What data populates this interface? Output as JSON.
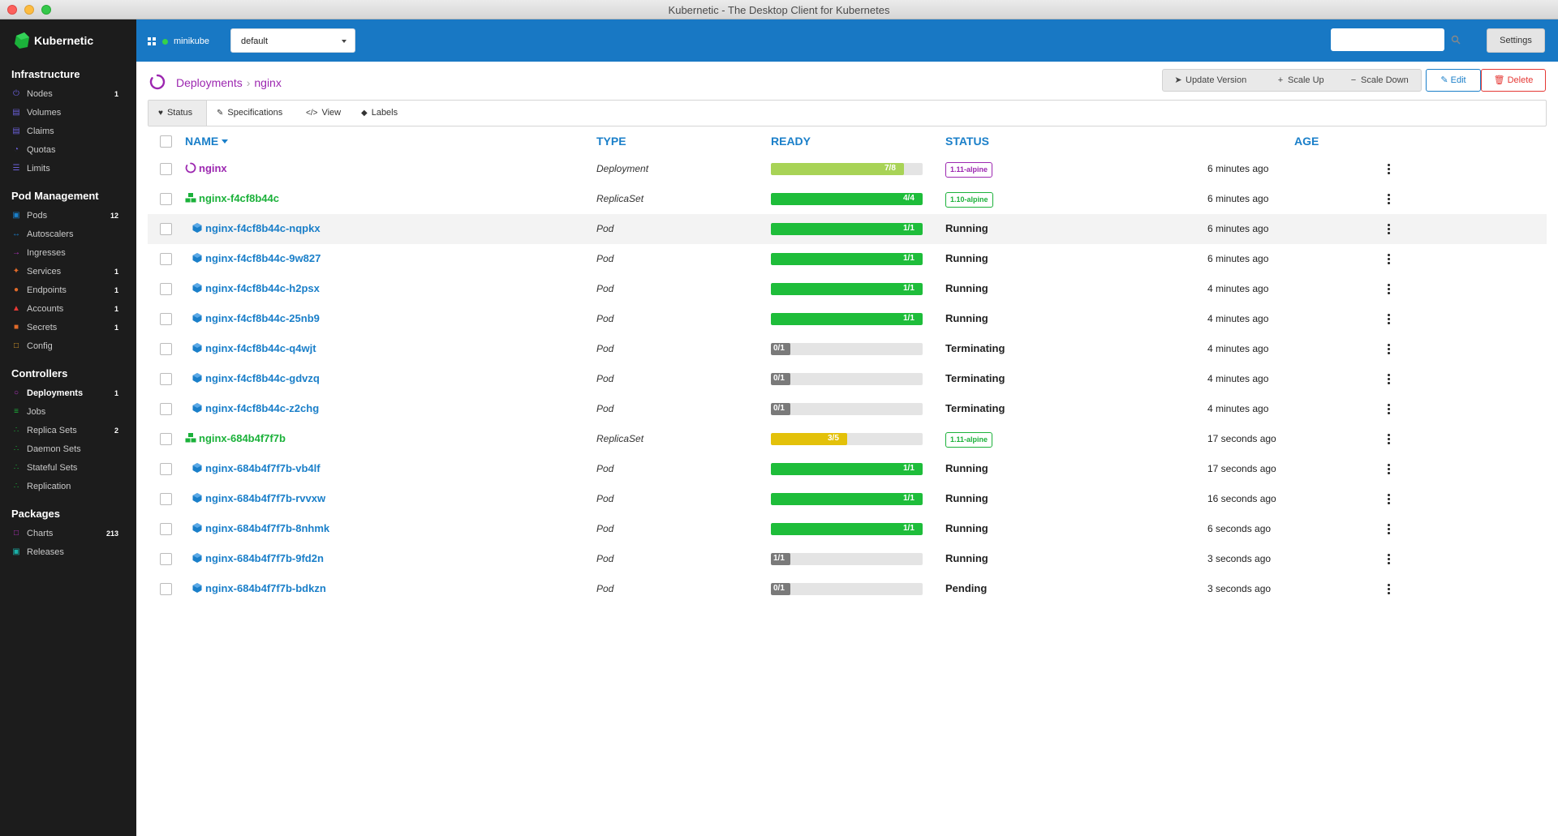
{
  "window": {
    "title": "Kubernetic - The Desktop Client for Kubernetes"
  },
  "brand": {
    "name": "Kubernetic"
  },
  "colors": {
    "sidebar": "#1c1c1c",
    "topbar": "#1878c4",
    "link": "#1a7fc9",
    "deployment": "#9c27b0",
    "replicaset": "#1bb13a",
    "ready_full": "#1ebd3a",
    "ready_partial_deploy": "#a8d356",
    "ready_partial_rs": "#e3c10a",
    "ready_zero": "#7a7a7a"
  },
  "sidebar": {
    "sections": [
      {
        "heading": "Infrastructure",
        "items": [
          {
            "label": "Nodes",
            "count": "1",
            "icon": "power-icon",
            "color": "#6a5fd6"
          },
          {
            "label": "Volumes",
            "count": "",
            "icon": "database-icon",
            "color": "#6a5fd6"
          },
          {
            "label": "Claims",
            "count": "",
            "icon": "database-icon",
            "color": "#6a5fd6"
          },
          {
            "label": "Quotas",
            "count": "",
            "icon": "gauge-icon",
            "color": "#6a5fd6"
          },
          {
            "label": "Limits",
            "count": "",
            "icon": "sliders-icon",
            "color": "#6a5fd6"
          }
        ]
      },
      {
        "heading": "Pod Management",
        "items": [
          {
            "label": "Pods",
            "count": "12",
            "icon": "cube-icon",
            "color": "#1a7fc9"
          },
          {
            "label": "Autoscalers",
            "count": "",
            "icon": "arrows-horizontal-icon",
            "color": "#1a7fc9"
          },
          {
            "label": "Ingresses",
            "count": "",
            "icon": "sign-in-icon",
            "color": "#b833c4"
          },
          {
            "label": "Services",
            "count": "1",
            "icon": "plug-icon",
            "color": "#e06a2a"
          },
          {
            "label": "Endpoints",
            "count": "1",
            "icon": "pin-icon",
            "color": "#e06a2a"
          },
          {
            "label": "Accounts",
            "count": "1",
            "icon": "user-icon",
            "color": "#e53935"
          },
          {
            "label": "Secrets",
            "count": "1",
            "icon": "lock-icon",
            "color": "#e06a2a"
          },
          {
            "label": "Config",
            "count": "",
            "icon": "map-icon",
            "color": "#e0a02a"
          }
        ]
      },
      {
        "heading": "Controllers",
        "items": [
          {
            "label": "Deployments",
            "count": "1",
            "icon": "circle-notch-icon",
            "color": "#b833c4",
            "active": true
          },
          {
            "label": "Jobs",
            "count": "",
            "icon": "tasks-icon",
            "color": "#1bb13a"
          },
          {
            "label": "Replica Sets",
            "count": "2",
            "icon": "cubes-icon",
            "color": "#1bb13a"
          },
          {
            "label": "Daemon Sets",
            "count": "",
            "icon": "cubes-icon",
            "color": "#1bb13a"
          },
          {
            "label": "Stateful Sets",
            "count": "",
            "icon": "cubes-icon",
            "color": "#1bb13a"
          },
          {
            "label": "Replication",
            "count": "",
            "icon": "cubes-icon",
            "color": "#1bb13a"
          }
        ]
      },
      {
        "heading": "Packages",
        "items": [
          {
            "label": "Charts",
            "count": "213",
            "icon": "map-icon",
            "color": "#b833c4"
          },
          {
            "label": "Releases",
            "count": "",
            "icon": "box-icon",
            "color": "#1ab0a8"
          }
        ]
      }
    ]
  },
  "topbar": {
    "cluster": "minikube",
    "namespace": "default",
    "search_placeholder": "",
    "settings_label": "Settings"
  },
  "breadcrumb": {
    "parent": "Deployments",
    "current": "nginx"
  },
  "actions": {
    "update_version": "Update Version",
    "scale_up": "Scale Up",
    "scale_down": "Scale Down",
    "edit": "Edit",
    "delete": "Delete"
  },
  "tabs": [
    {
      "label": "Status",
      "icon": "heartbeat-icon",
      "active": true
    },
    {
      "label": "Specifications",
      "icon": "pencil-icon"
    },
    {
      "label": "View",
      "icon": "code-icon"
    },
    {
      "label": "Labels",
      "icon": "tags-icon"
    }
  ],
  "table": {
    "headers": {
      "name": "NAME",
      "type": "TYPE",
      "ready": "READY",
      "status": "STATUS",
      "age": "AGE"
    },
    "rows": [
      {
        "name": "nginx",
        "kind": "deployment",
        "type": "Deployment",
        "ready": "7/8",
        "ready_fraction": 0.875,
        "status": "1.11-alpine",
        "status_kind": "badge",
        "age": "6 minutes ago"
      },
      {
        "name": "nginx-f4cf8b44c",
        "kind": "replicaset",
        "type": "ReplicaSet",
        "ready": "4/4",
        "ready_fraction": 1,
        "status": "1.10-alpine",
        "status_kind": "badge",
        "age": "6 minutes ago"
      },
      {
        "name": "nginx-f4cf8b44c-nqpkx",
        "kind": "pod",
        "type": "Pod",
        "ready": "1/1",
        "ready_fraction": 1,
        "status": "Running",
        "status_kind": "text",
        "age": "6 minutes ago",
        "hover": true
      },
      {
        "name": "nginx-f4cf8b44c-9w827",
        "kind": "pod",
        "type": "Pod",
        "ready": "1/1",
        "ready_fraction": 1,
        "status": "Running",
        "status_kind": "text",
        "age": "6 minutes ago"
      },
      {
        "name": "nginx-f4cf8b44c-h2psx",
        "kind": "pod",
        "type": "Pod",
        "ready": "1/1",
        "ready_fraction": 1,
        "status": "Running",
        "status_kind": "text",
        "age": "4 minutes ago"
      },
      {
        "name": "nginx-f4cf8b44c-25nb9",
        "kind": "pod",
        "type": "Pod",
        "ready": "1/1",
        "ready_fraction": 1,
        "status": "Running",
        "status_kind": "text",
        "age": "4 minutes ago"
      },
      {
        "name": "nginx-f4cf8b44c-q4wjt",
        "kind": "pod",
        "type": "Pod",
        "ready": "0/1",
        "ready_fraction": 0,
        "status": "Terminating",
        "status_kind": "text",
        "age": "4 minutes ago"
      },
      {
        "name": "nginx-f4cf8b44c-gdvzq",
        "kind": "pod",
        "type": "Pod",
        "ready": "0/1",
        "ready_fraction": 0,
        "status": "Terminating",
        "status_kind": "text",
        "age": "4 minutes ago"
      },
      {
        "name": "nginx-f4cf8b44c-z2chg",
        "kind": "pod",
        "type": "Pod",
        "ready": "0/1",
        "ready_fraction": 0,
        "status": "Terminating",
        "status_kind": "text",
        "age": "4 minutes ago"
      },
      {
        "name": "nginx-684b4f7f7b",
        "kind": "replicaset",
        "type": "ReplicaSet",
        "ready": "3/5",
        "ready_fraction": 0.5,
        "status": "1.11-alpine",
        "status_kind": "badge",
        "age": "17 seconds ago"
      },
      {
        "name": "nginx-684b4f7f7b-vb4lf",
        "kind": "pod",
        "type": "Pod",
        "ready": "1/1",
        "ready_fraction": 1,
        "status": "Running",
        "status_kind": "text",
        "age": "17 seconds ago"
      },
      {
        "name": "nginx-684b4f7f7b-rvvxw",
        "kind": "pod",
        "type": "Pod",
        "ready": "1/1",
        "ready_fraction": 1,
        "status": "Running",
        "status_kind": "text",
        "age": "16 seconds ago"
      },
      {
        "name": "nginx-684b4f7f7b-8nhmk",
        "kind": "pod",
        "type": "Pod",
        "ready": "1/1",
        "ready_fraction": 1,
        "status": "Running",
        "status_kind": "text",
        "age": "6 seconds ago"
      },
      {
        "name": "nginx-684b4f7f7b-9fd2n",
        "kind": "pod",
        "type": "Pod",
        "ready": "1/1",
        "ready_fraction": 0,
        "status": "Running",
        "status_kind": "text",
        "age": "3 seconds ago"
      },
      {
        "name": "nginx-684b4f7f7b-bdkzn",
        "kind": "pod",
        "type": "Pod",
        "ready": "0/1",
        "ready_fraction": 0,
        "status": "Pending",
        "status_kind": "text",
        "age": "3 seconds ago"
      }
    ]
  }
}
